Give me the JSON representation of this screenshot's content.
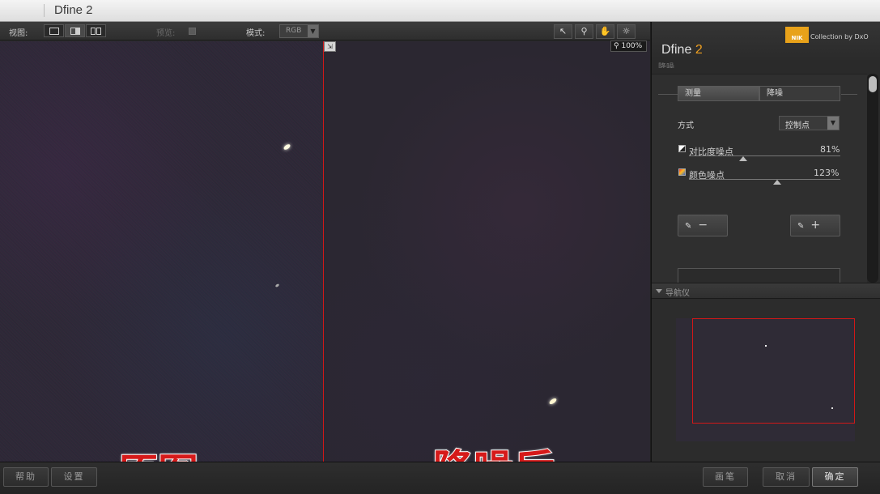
{
  "window": {
    "title": "Dfine 2"
  },
  "viewbar": {
    "view_label": "视图:",
    "preview_label": "预览:",
    "mode_label": "模式:",
    "mode_value": "RGB",
    "zoom": "100%"
  },
  "tools": [
    "arrow-tool",
    "zoom-tool",
    "hand-tool",
    "light-tool"
  ],
  "overlay": {
    "left": "原图",
    "right": "降噪后"
  },
  "panel": {
    "logo": "NIK",
    "collection": "Collection by DxO",
    "product_name": "Dfine",
    "product_version": "2",
    "section_title": "降噪",
    "tabs": {
      "measure": "测量",
      "reduce": "降噪"
    },
    "method_label": "方式",
    "method_value": "控制点",
    "sliders": {
      "contrast": {
        "label": "对比度噪点",
        "value": "81%",
        "level": 0.81
      },
      "color": {
        "label": "颜色噪点",
        "value": "123%",
        "level": 0.62
      }
    },
    "navigator_title": "导航仪"
  },
  "bottom": {
    "help": "帮助",
    "settings": "设置",
    "brush": "画笔",
    "cancel": "取消",
    "ok": "确定"
  },
  "colors": {
    "accent": "#f0a020",
    "split_line": "#d01818",
    "overlay_text": "#d61a1a"
  }
}
